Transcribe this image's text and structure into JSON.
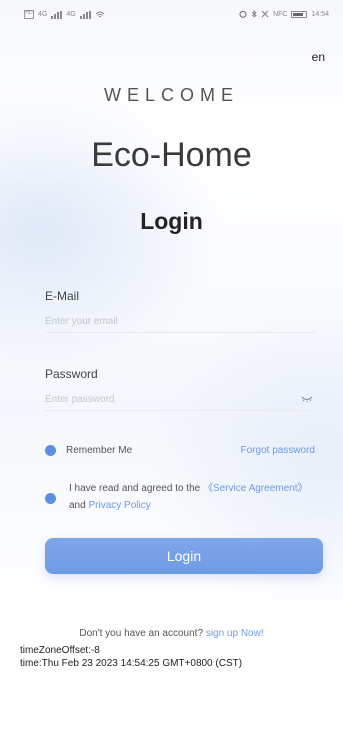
{
  "status_bar": {
    "sim": "HD",
    "signal_1": "4G",
    "signal_2": "4G",
    "right_icons": "NFC",
    "time": "14:54"
  },
  "language": "en",
  "welcome": "WELCOME",
  "brand": "Eco-Home",
  "title": "Login",
  "email": {
    "label": "E-Mail",
    "placeholder": "Enter your email",
    "value": ""
  },
  "password": {
    "label": "Password",
    "placeholder": "Enter password",
    "value": ""
  },
  "remember": {
    "label": "Remember Me",
    "checked": true
  },
  "forgot": "Forgot password",
  "agreement": {
    "checked": true,
    "prefix": "I have read and agreed to the ",
    "service": "《Service Agreement》",
    "middle": " and ",
    "privacy": "Privacy Policy"
  },
  "login_button": "Login",
  "signup": {
    "prompt": "Don't you have an account? ",
    "link": "sign up Now!"
  },
  "debug": {
    "tz": "timeZoneOffset:-8",
    "time": "time:Thu Feb 23 2023 14:54:25 GMT+0800 (CST)"
  },
  "colors": {
    "accent": "#6f9be6",
    "link": "#6b9be6",
    "text": "#333333"
  }
}
